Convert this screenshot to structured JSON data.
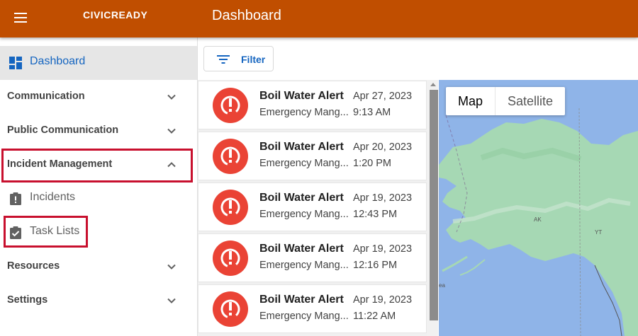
{
  "header": {
    "brand": "CIVICREADY",
    "title": "Dashboard"
  },
  "sidebar": {
    "dashboard_label": "Dashboard",
    "communication_label": "Communication",
    "public_communication_label": "Public Communication",
    "incident_management_label": "Incident Management",
    "incidents_label": "Incidents",
    "task_lists_label": "Task Lists",
    "resources_label": "Resources",
    "settings_label": "Settings"
  },
  "toolbar": {
    "filter_label": "Filter"
  },
  "alerts": [
    {
      "title": "Boil Water Alert",
      "subtitle": "Emergency Mang...",
      "date": "Apr 27, 2023",
      "time": "9:13 AM"
    },
    {
      "title": "Boil Water Alert",
      "subtitle": "Emergency Mang...",
      "date": "Apr 20, 2023",
      "time": "1:20 PM"
    },
    {
      "title": "Boil Water Alert",
      "subtitle": "Emergency Mang...",
      "date": "Apr 19, 2023",
      "time": "12:43 PM"
    },
    {
      "title": "Boil Water Alert",
      "subtitle": "Emergency Mang...",
      "date": "Apr 19, 2023",
      "time": "12:16 PM"
    },
    {
      "title": "Boil Water Alert",
      "subtitle": "Emergency Mang...",
      "date": "Apr 19, 2023",
      "time": "11:22 AM"
    }
  ],
  "map": {
    "map_label": "Map",
    "satellite_label": "Satellite",
    "region_ak": "AK",
    "region_yt": "YT",
    "water_label": "ea"
  },
  "colors": {
    "header": "#c04e00",
    "accent": "#1565c0",
    "alert": "#ea4335",
    "highlight": "#c8102e",
    "water": "#8fb4e8",
    "land": "#a6d8b4"
  },
  "icons": {
    "menu": "hamburger-menu-icon",
    "dashboard": "dashboard-grid-icon",
    "incidents": "clipboard-alert-icon",
    "task_lists": "clipboard-check-icon",
    "filter": "filter-lines-icon",
    "alert": "exclamation-circle-icon",
    "chevron": "chevron-icon"
  }
}
